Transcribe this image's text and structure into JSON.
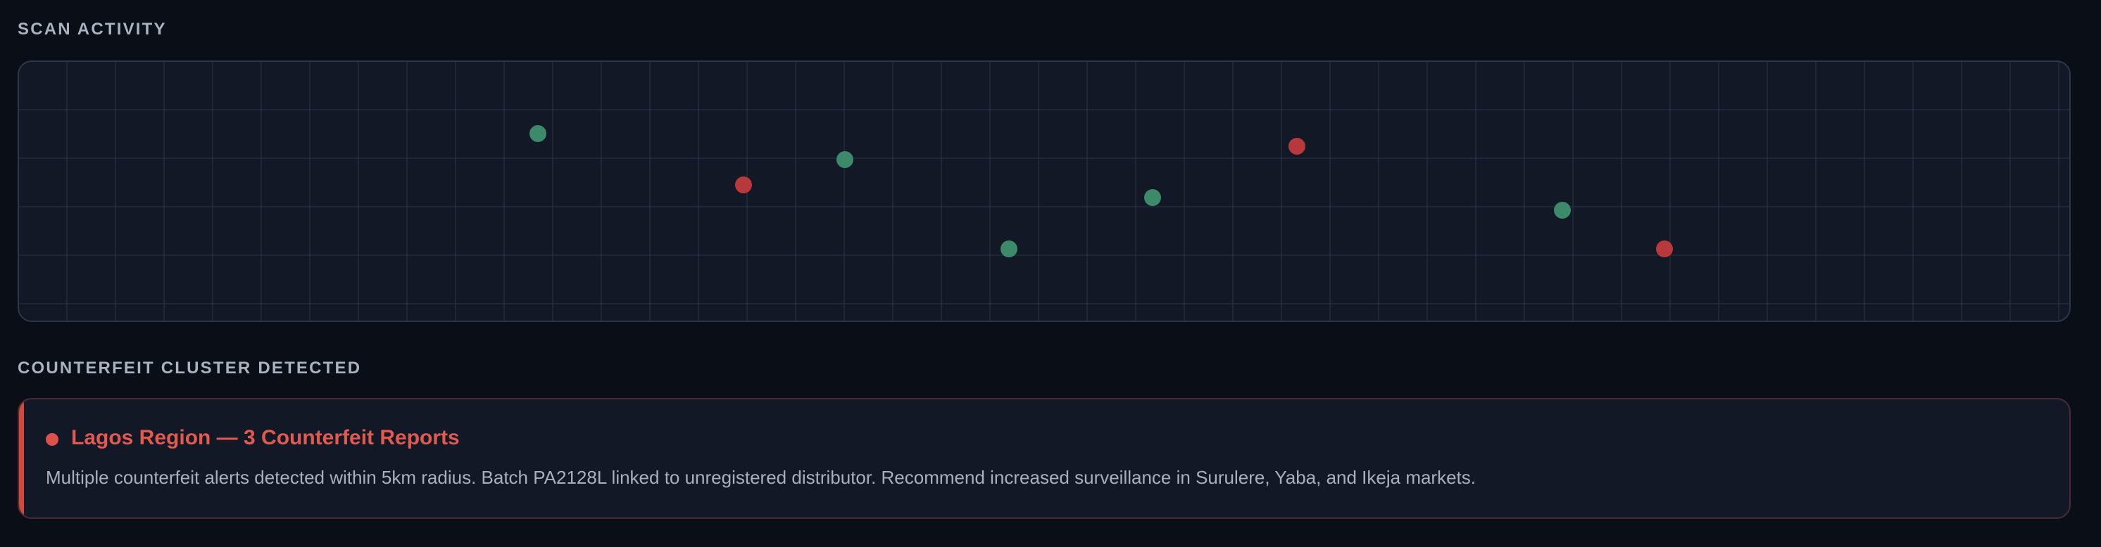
{
  "scan_activity": {
    "title": "SCAN ACTIVITY",
    "scans": [
      {
        "status": "clean"
      },
      {
        "status": "counterfeit"
      },
      {
        "status": "clean"
      },
      {
        "status": "clean"
      },
      {
        "status": "clean"
      },
      {
        "status": "counterfeit"
      },
      {
        "status": "clean"
      },
      {
        "status": "counterfeit"
      }
    ]
  },
  "cluster": {
    "title": "COUNTERFEIT CLUSTER DETECTED",
    "alert": {
      "heading": "Lagos Region — 3 Counterfeit Reports",
      "body": "Multiple counterfeit alerts detected within 5km radius. Batch PA2128L linked to unregistered distributor. Recommend increased surveillance in Surulere, Yaba, and Ikeja markets."
    }
  },
  "colors": {
    "clean": "#3c8a69",
    "counterfeit": "#b8393c",
    "alert_accent": "#d2483f"
  }
}
